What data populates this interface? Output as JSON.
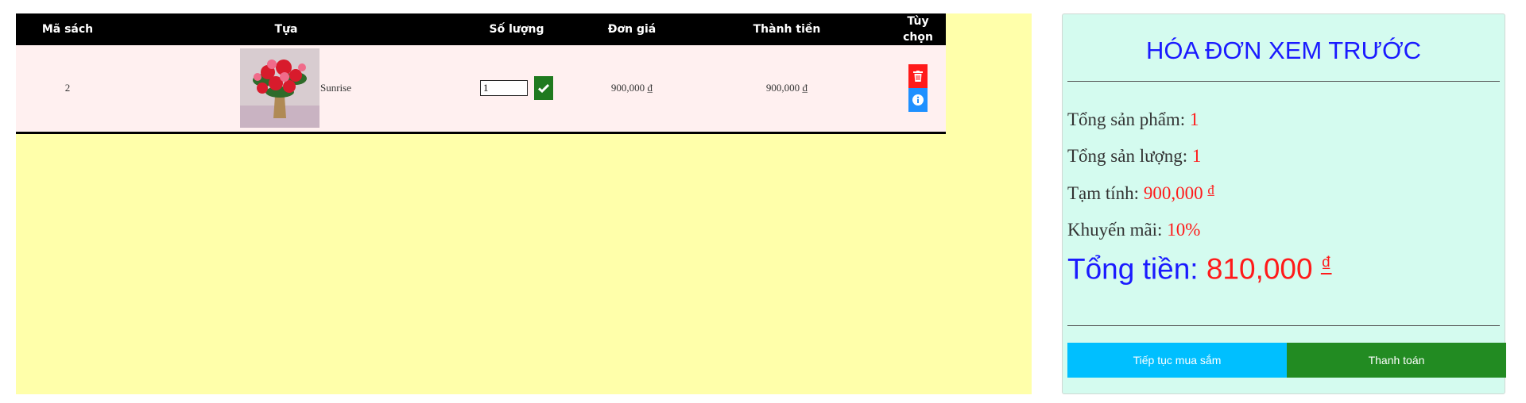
{
  "table": {
    "headers": [
      "Mã sách",
      "Tựa",
      "Số lượng",
      "Đơn giá",
      "Thành tiền",
      "Tùy chọn"
    ],
    "rows": [
      {
        "id": "2",
        "title": "Sunrise",
        "quantity": "1",
        "unit_price": "900,000 ₫",
        "line_total": "900,000 ₫"
      }
    ]
  },
  "invoice": {
    "title": "HÓA ĐƠN XEM TRƯỚC",
    "products_label": "Tổng sản phẩm:",
    "products_value": "1",
    "quantity_label": "Tổng sản lượng:",
    "quantity_value": "1",
    "subtotal_label": "Tạm tính:",
    "subtotal_value": "900,000",
    "discount_label": "Khuyến mãi:",
    "discount_value": "10%",
    "total_label": "Tổng tiền:",
    "total_value": "810,000",
    "currency": "₫",
    "continue_label": "Tiếp tục mua sắm",
    "pay_label": "Thanh toán"
  },
  "colors": {
    "cart_background": "#ffffaa",
    "invoice_background": "#d4fbef",
    "accent_blue": "#1a1aff",
    "accent_red": "#ff1a1a",
    "continue_button": "#00bfff",
    "pay_button": "#228b22"
  },
  "icons": {
    "confirm": "check-icon",
    "delete": "trash-icon",
    "details": "info-icon"
  }
}
